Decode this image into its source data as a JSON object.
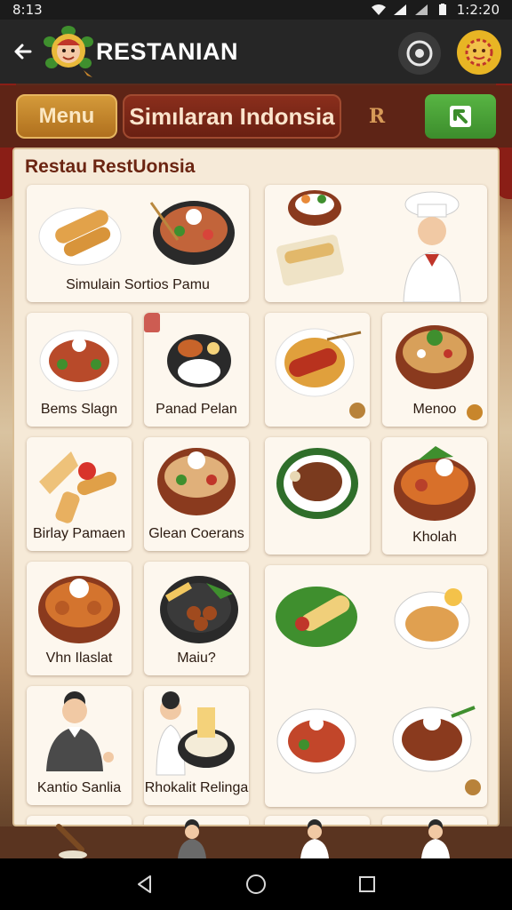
{
  "status_bar": {
    "time_left": "8:13",
    "time_right": "1:2:20"
  },
  "app_bar": {
    "title": "RESTANIAN",
    "icons": [
      "back-arrow-icon",
      "logo-mascot",
      "target-icon",
      "avatar-icon"
    ]
  },
  "tabs": {
    "menu_label": "Menu",
    "simulation_label": "Simılaran Indonsia",
    "ornament": "R",
    "go_icon": "arrow-up-left-icon"
  },
  "panel": {
    "title": "Restau RestUonsia"
  },
  "cards": [
    {
      "label": "Simulain Sortios Pamu",
      "icon": "spring-rolls-and-noodle-bowl"
    },
    {
      "label": "",
      "icon": "rice-bowl-rolls-chef"
    },
    {
      "label": "Bems Slagn",
      "icon": "salad-plate"
    },
    {
      "label": "Panad Pelan",
      "icon": "rice-pan"
    },
    {
      "label": "",
      "icon": "satay-noodles"
    },
    {
      "label": "Menoo",
      "icon": "noodle-bowl"
    },
    {
      "label": "Birlay Pamaen",
      "icon": "rolls-and-tomato"
    },
    {
      "label": "Glean Coerans",
      "icon": "soup-bowl"
    },
    {
      "label": "",
      "icon": "meat-plate"
    },
    {
      "label": "Kholah",
      "icon": "curry-bowl"
    },
    {
      "label": "Vhn Ilaslat",
      "icon": "fried-chicken-bowl"
    },
    {
      "label": "Maiu?",
      "icon": "fries-and-meatballs"
    },
    {
      "label": "",
      "icon": "banana-leaf-and-noodle-plates"
    },
    {
      "label": "Kantio Sanlia",
      "icon": "waiter-figure"
    },
    {
      "label": "Rhokalit Relinga",
      "icon": "chef-with-rice-pan"
    }
  ],
  "colors": {
    "accent_orange": "#c8862c",
    "accent_maroon": "#6a2012",
    "accent_green": "#48a036",
    "panel_bg": "#f6ead8"
  }
}
